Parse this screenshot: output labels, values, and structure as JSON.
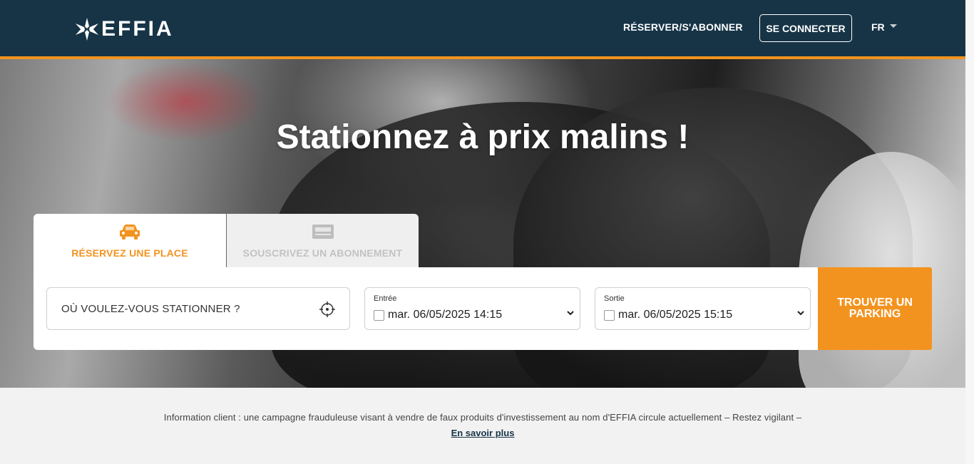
{
  "header": {
    "logo_text": "EFFIA",
    "nav_reserve": "RÉSERVER/S'ABONNER",
    "connect_label": "SE CONNECTER",
    "language": "FR"
  },
  "hero": {
    "title": "Stationnez à prix malins !"
  },
  "tabs": [
    {
      "label": "RÉSERVEZ UNE PLACE",
      "icon": "car-icon",
      "active": true
    },
    {
      "label": "SOUSCRIVEZ UN ABONNEMENT",
      "icon": "subscription-card-icon",
      "active": false
    }
  ],
  "search": {
    "location_placeholder": "OÙ VOULEZ-VOUS STATIONNER ?",
    "entry_label": "Entrée",
    "entry_value": "mar. 06/05/2025 14:15",
    "exit_label": "Sortie",
    "exit_value": "mar. 06/05/2025 15:15",
    "find_button": "TROUVER UN PARKING"
  },
  "info": {
    "text": "Information client : une campagne frauduleuse visant à vendre de faux produits d'investissement au nom d'EFFIA circule actuellement – Restez vigilant –",
    "link": "En savoir plus"
  },
  "colors": {
    "header_bg": "#173447",
    "accent": "#f3931f",
    "page_bg": "#f2f2f2"
  }
}
